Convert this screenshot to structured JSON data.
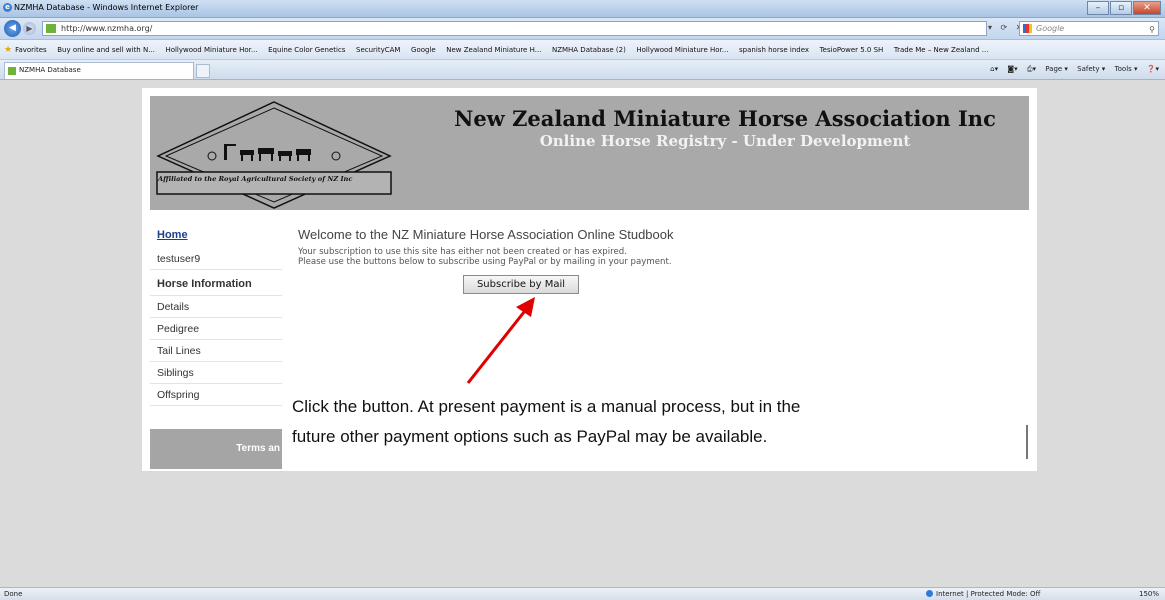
{
  "window": {
    "title": "NZMHA Database - Windows Internet Explorer"
  },
  "address": {
    "url": "http://www.nzmha.org/",
    "search_placeholder": "Google"
  },
  "favorites": {
    "label": "Favorites",
    "items": [
      "Buy online and sell with N...",
      "Hollywood Miniature Hor...",
      "Equine Color Genetics",
      "SecurityCAM",
      "Google",
      "New Zealand Miniature H...",
      "NZMHA Database (2)",
      "Hollywood Miniature Hor...",
      "spanish horse index",
      "TesioPower 5.0 SH",
      "Trade Me – New Zealand ..."
    ]
  },
  "tab": {
    "label": "NZMHA Database"
  },
  "command_bar": {
    "page": "Page ▾",
    "safety": "Safety ▾",
    "tools": "Tools ▾",
    "help": "❓▾"
  },
  "banner": {
    "title": "New Zealand Miniature Horse Association Inc",
    "subtitle": "Online Horse Registry - Under Development",
    "affiliation": "Affiliated to the Royal Agricultural Society of NZ Inc"
  },
  "sidebar": {
    "home": "Home",
    "user": "testuser9",
    "section": "Horse Information",
    "items": [
      "Details",
      "Pedigree",
      "Tail Lines",
      "Siblings",
      "Offspring"
    ],
    "terms": "Terms an"
  },
  "main": {
    "welcome": "Welcome to the NZ Miniature Horse Association Online Studbook",
    "line1": "Your subscription to use this site has either not been created or has expired.",
    "line2": "Please use the buttons below to subscribe using PayPal or by mailing in your payment.",
    "subscribe_label": "Subscribe by Mail"
  },
  "annotation": {
    "line1": "Click the button.  At present payment is a manual process, but in the",
    "line2": "future other payment options such as PayPal may be available.",
    "arrow_color": "#e00000"
  },
  "status": {
    "left": "Done",
    "zone": "Internet | Protected Mode: Off",
    "zoom": "150%"
  }
}
